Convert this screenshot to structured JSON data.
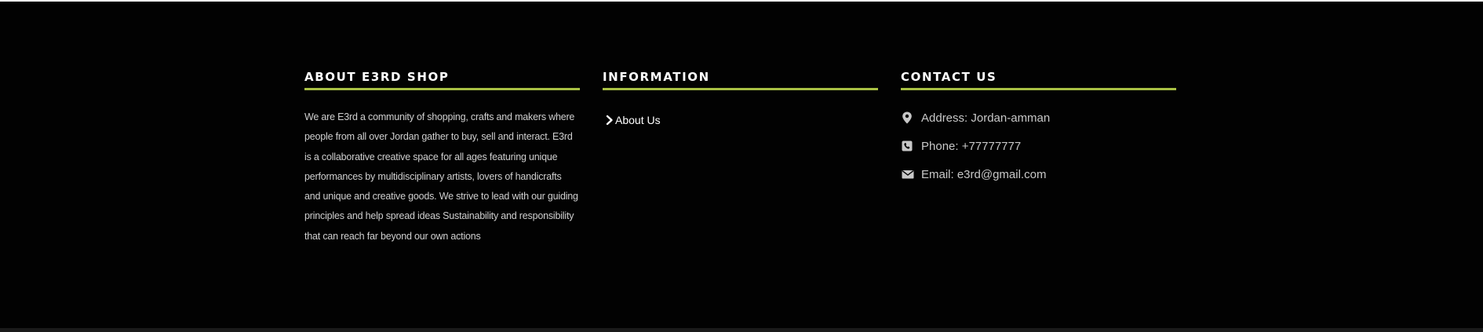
{
  "footer": {
    "about": {
      "title": "ABOUT E3RD SHOP",
      "text": "We are E3rd a community of shopping, crafts and makers where people from all over Jordan gather to buy, sell and interact. E3rd is a collaborative creative space for all ages featuring unique performances by multidisciplinary artists, lovers of handicrafts and unique and creative goods. We strive to lead with our guiding principles and help spread ideas Sustainability and responsibility that can reach far beyond our own actions"
    },
    "information": {
      "title": "INFORMATION",
      "links": [
        {
          "label": "About Us",
          "icon": "chevron-right-icon"
        }
      ]
    },
    "contact": {
      "title": "CONTACT US",
      "items": [
        {
          "icon": "map-marker-icon",
          "text": "Address: Jordan-amman"
        },
        {
          "icon": "phone-icon",
          "text": "Phone: +77777777"
        },
        {
          "icon": "envelope-icon",
          "text": "Email: e3rd@gmail.com"
        }
      ]
    },
    "colors": {
      "background": "#020202",
      "accent": "#a8c044",
      "heading": "#ffffff",
      "body_text": "#d0d0d0"
    }
  }
}
